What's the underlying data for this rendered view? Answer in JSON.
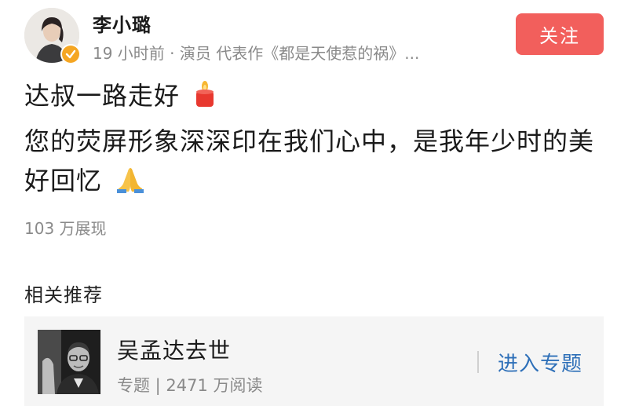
{
  "author": {
    "name": "李小璐",
    "verified": true
  },
  "post": {
    "meta": "19 小时前 · 演员 代表作《都是天使惹的祸》...",
    "follow_label": "关注",
    "line1": "达叔一路走好",
    "line1_emoji": "candle-icon",
    "line2": "您的荧屏形象深深印在我们心中，是我年少时的美",
    "line3": "好回忆",
    "line3_emoji": "pray-hands-icon",
    "impressions": "103 万展现"
  },
  "related": {
    "title": "相关推荐",
    "topic": {
      "title": "吴孟达去世",
      "meta": "专题 | 2471 万阅读",
      "enter_label": "进入专题"
    }
  },
  "colors": {
    "follow_button": "#f25f5c",
    "link_blue": "#2d6fb8",
    "meta_gray": "#8a8a8a",
    "verified_gold": "#f5a623"
  }
}
